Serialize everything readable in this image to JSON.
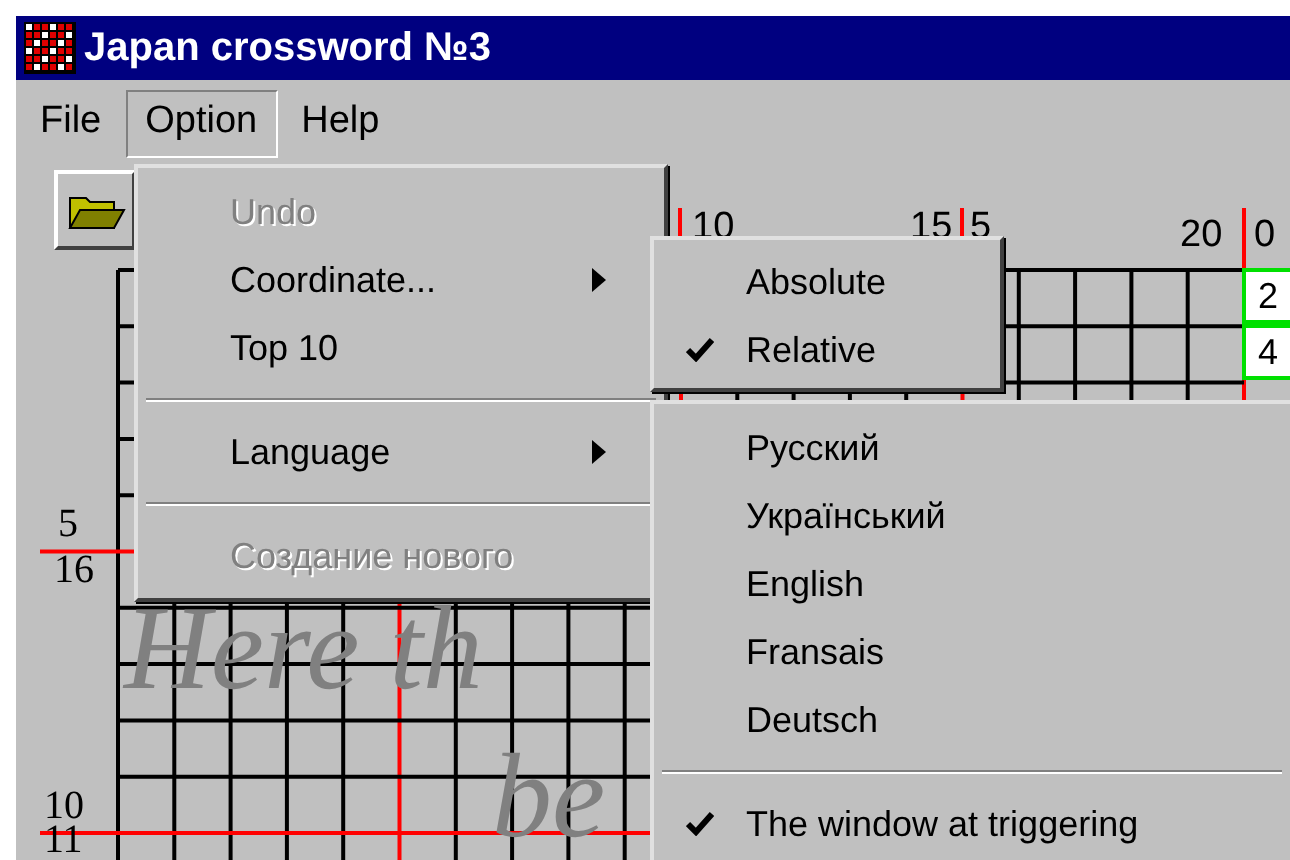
{
  "window": {
    "title": "Japan crossword №3"
  },
  "menu_bar": [
    {
      "label": "File",
      "selected": false
    },
    {
      "label": "Option",
      "selected": true
    },
    {
      "label": "Help",
      "selected": false
    }
  ],
  "option_menu": [
    {
      "kind": "item",
      "label": "Undo",
      "disabled": true,
      "submenu": false
    },
    {
      "kind": "item",
      "label": "Coordinate...",
      "disabled": false,
      "submenu": true
    },
    {
      "kind": "item",
      "label": "Top 10",
      "disabled": false,
      "submenu": false
    },
    {
      "kind": "separator"
    },
    {
      "kind": "item",
      "label": "Language",
      "disabled": false,
      "submenu": true
    },
    {
      "kind": "separator"
    },
    {
      "kind": "item",
      "label": "Создание нового",
      "disabled": true,
      "submenu": false
    }
  ],
  "coordinate_submenu": [
    {
      "label": "Absolute",
      "checked": false
    },
    {
      "label": "Relative",
      "checked": true
    }
  ],
  "language_submenu": [
    {
      "kind": "item",
      "label": "Русский",
      "checked": false
    },
    {
      "kind": "item",
      "label": "Український",
      "checked": false
    },
    {
      "kind": "item",
      "label": "English",
      "checked": false
    },
    {
      "kind": "item",
      "label": "Fransais",
      "checked": false
    },
    {
      "kind": "item",
      "label": "Deutsch",
      "checked": false
    },
    {
      "kind": "separator"
    },
    {
      "kind": "item",
      "label": "The window at triggering",
      "checked": true
    }
  ],
  "puzzle": {
    "column_numbers": [
      "10",
      "15",
      "5",
      "20",
      "0"
    ],
    "row_numbers": [
      "5",
      "16",
      "10",
      "11"
    ],
    "clue_cells": [
      "2",
      "4"
    ],
    "overlay_text": [
      "Here th",
      "be"
    ]
  }
}
